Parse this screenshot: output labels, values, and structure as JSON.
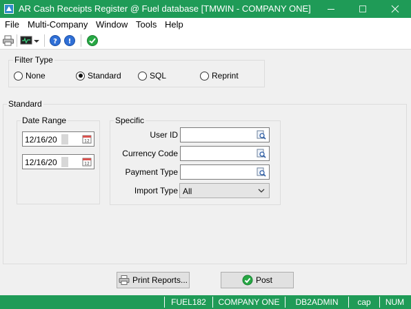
{
  "window": {
    "title": "AR Cash Receipts Register @ Fuel database [TMWIN - COMPANY ONE]",
    "accent_color": "#1f9b57"
  },
  "menu": {
    "items": [
      "File",
      "Multi-Company",
      "Window",
      "Tools",
      "Help"
    ]
  },
  "toolbar": {
    "icons": [
      "printer-icon",
      "monitor-icon",
      "dropdown-arrow-icon",
      "help-icon",
      "info-icon",
      "check-icon"
    ]
  },
  "filter_type": {
    "title": "Filter Type",
    "options": [
      "None",
      "Standard",
      "SQL",
      "Reprint"
    ],
    "selected": "Standard"
  },
  "standard": {
    "title": "Standard",
    "date_range": {
      "title": "Date Range",
      "from": "12/16/20",
      "to": "12/16/20"
    },
    "specific": {
      "title": "Specific",
      "user_id_label": "User ID",
      "user_id_value": "",
      "currency_code_label": "Currency Code",
      "currency_code_value": "",
      "payment_type_label": "Payment Type",
      "payment_type_value": "",
      "import_type_label": "Import Type",
      "import_type_value": "All"
    }
  },
  "buttons": {
    "print_reports": "Print Reports...",
    "post": "Post"
  },
  "status": {
    "items": [
      "FUEL182",
      "COMPANY ONE",
      "DB2ADMIN",
      "cap",
      "NUM"
    ]
  }
}
